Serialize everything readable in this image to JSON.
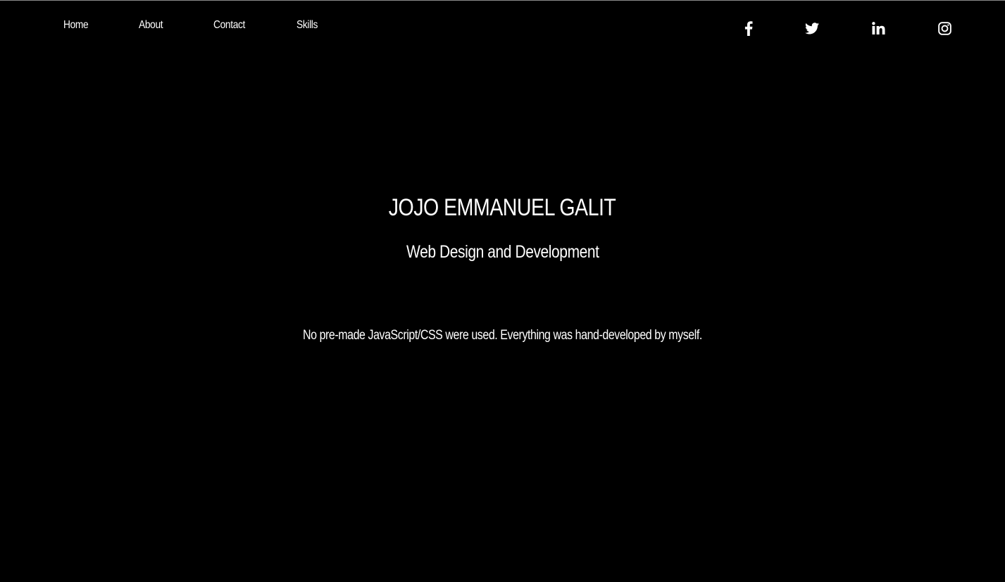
{
  "nav": {
    "links": [
      {
        "label": "Home"
      },
      {
        "label": "About"
      },
      {
        "label": "Contact"
      },
      {
        "label": "Skills"
      }
    ],
    "social": [
      {
        "icon": "facebook-icon"
      },
      {
        "icon": "twitter-icon"
      },
      {
        "icon": "linkedin-icon"
      },
      {
        "icon": "instagram-icon"
      }
    ]
  },
  "hero": {
    "name": "JOJO EMMANUEL GALIT",
    "tagline": "Web Design and Development",
    "note": "No pre-made JavaScript/CSS were used. Everything was hand-developed by myself."
  },
  "colors": {
    "background": "#000000",
    "text": "#ffffff"
  }
}
